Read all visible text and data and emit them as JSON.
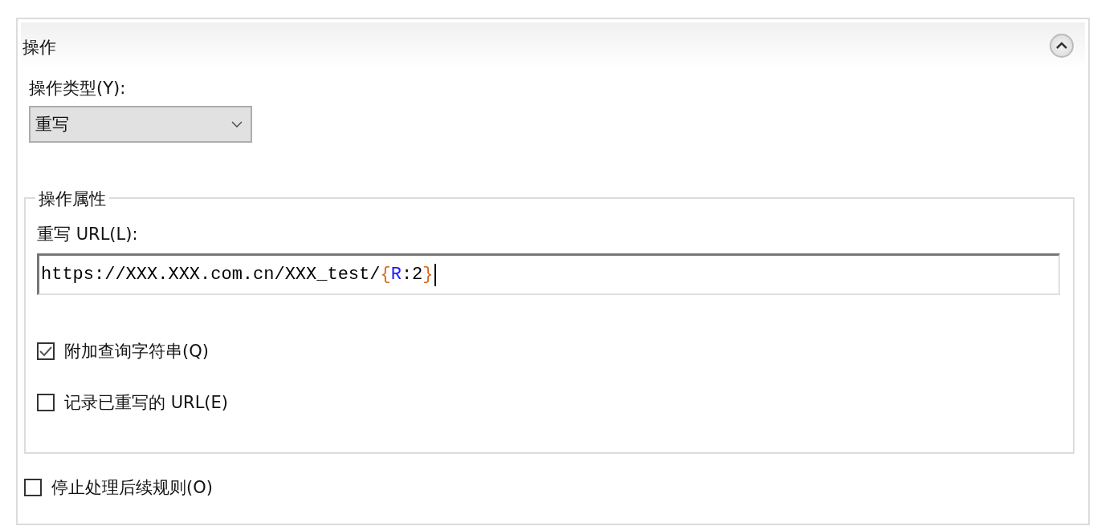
{
  "section": {
    "title": "操作",
    "expanded": true
  },
  "action_type": {
    "label": "操作类型(Y):",
    "value": "重写"
  },
  "properties": {
    "legend": "操作属性",
    "url": {
      "label": "重写 URL(L):",
      "segments": [
        {
          "text": "https://XXX.XXX.com.cn/XXX_test/",
          "color": "#000000"
        },
        {
          "text": "{",
          "color": "#d2691e"
        },
        {
          "text": "R",
          "color": "#1a1aff"
        },
        {
          "text": ":2",
          "color": "#000000"
        },
        {
          "text": "}",
          "color": "#d2691e"
        }
      ]
    },
    "options": [
      {
        "label": "附加查询字符串(Q)",
        "checked": true
      },
      {
        "label": "记录已重写的 URL(E)",
        "checked": false
      }
    ]
  },
  "stop_processing": {
    "label": "停止处理后续规则(O)",
    "checked": false
  }
}
